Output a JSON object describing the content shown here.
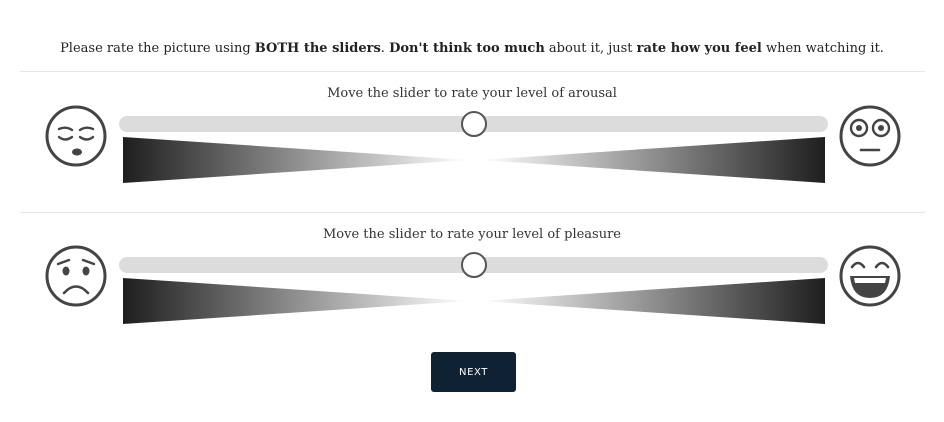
{
  "instructions": {
    "part1": "Please rate the picture using ",
    "bold1": "BOTH the sliders",
    "part2": ". ",
    "bold2": "Don't think too much",
    "part3": " about it, just ",
    "bold3": "rate how you feel",
    "part4": " when watching it."
  },
  "sliders": [
    {
      "label": "Move the slider to rate your level of arousal",
      "left_icon": "sleepy-face-icon",
      "right_icon": "wide-eyed-face-icon",
      "value": 0.5
    },
    {
      "label": "Move the slider to rate your level of pleasure",
      "left_icon": "sad-face-icon",
      "right_icon": "grinning-face-icon",
      "value": 0.5
    }
  ],
  "next_button": {
    "label": "NEXT"
  },
  "colors": {
    "track": "#dcdcdc",
    "thumb_border": "#555555",
    "wedge_dark": "#1e1e1e",
    "button_bg": "#0f2234",
    "button_text": "#ffffff",
    "face_stroke": "#444444"
  }
}
